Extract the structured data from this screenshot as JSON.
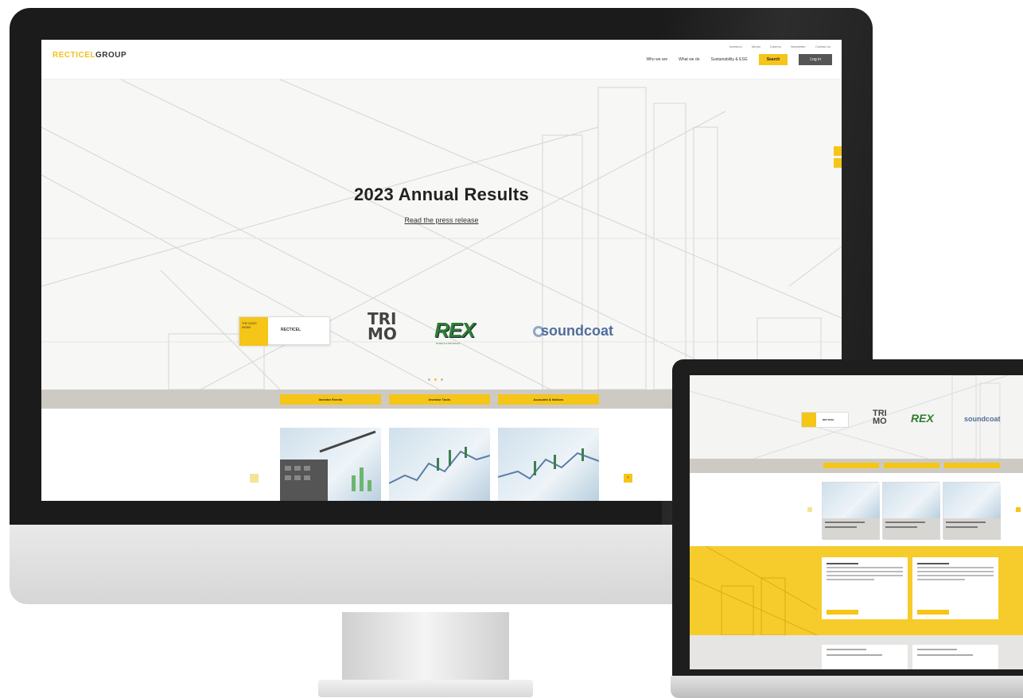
{
  "site": {
    "logo_primary": "RECTICEL",
    "logo_secondary": "GROUP",
    "top_links": [
      "Investors",
      "Media",
      "Careers",
      "Newsletter",
      "Contact us"
    ],
    "nav": [
      "Who we are",
      "What we do",
      "Sustainability & ESG"
    ],
    "search_label": "Search",
    "login_label": "Log in"
  },
  "hero": {
    "title": "2023 Annual Results",
    "link": "Read the press release",
    "dots_active": 1
  },
  "brands": {
    "recticel_badge": "THE GOOD INSIDE",
    "recticel_name": "RECTICEL",
    "trimo_line1": "TRI",
    "trimo_line2": "MO",
    "rex": "REX",
    "rex_sub": "PANELS & PROFILES",
    "soundcoat": "soundcoat"
  },
  "band_buttons": [
    "Investor Events",
    "Investor Tools",
    "Accounts & Notices"
  ],
  "colors": {
    "accent": "#f5c518",
    "band": "#cdcac4",
    "dark_button": "#555555",
    "bezel": "#1b1b1b"
  }
}
